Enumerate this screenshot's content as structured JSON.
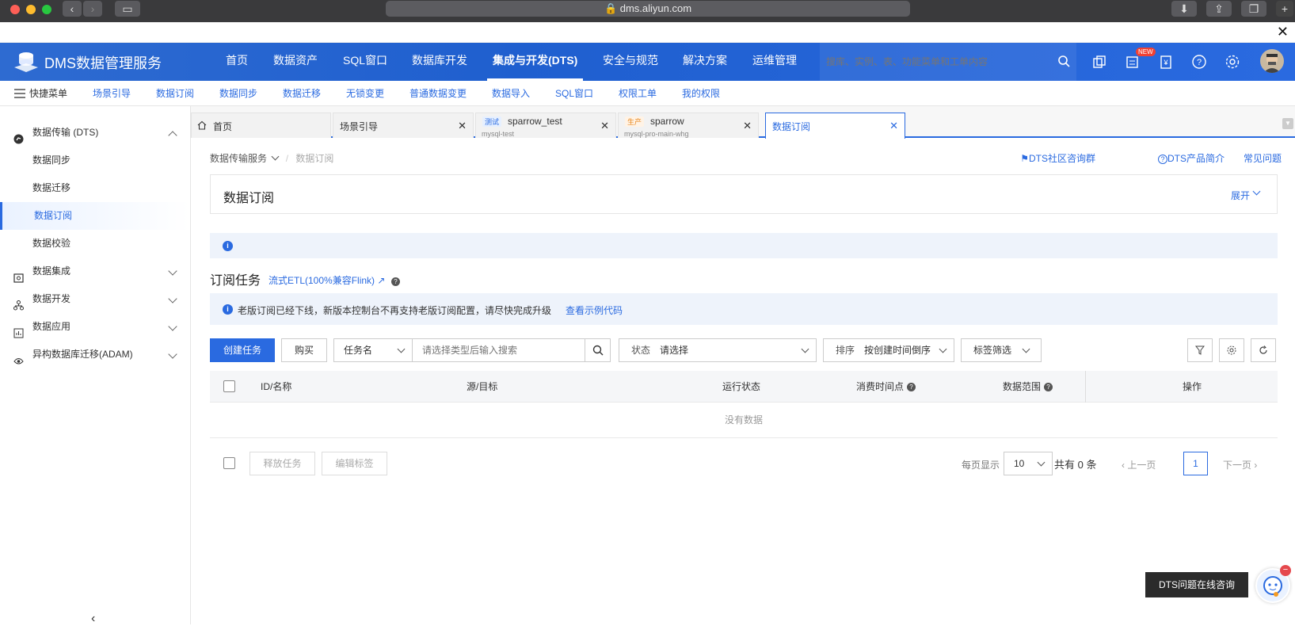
{
  "browser": {
    "url": "dms.aliyun.com"
  },
  "header": {
    "logo_text": "DMS数据管理服务",
    "nav": [
      {
        "label": "首页"
      },
      {
        "label": "数据资产"
      },
      {
        "label": "SQL窗口"
      },
      {
        "label": "数据库开发"
      },
      {
        "label": "集成与开发(DTS)"
      },
      {
        "label": "安全与规范"
      },
      {
        "label": "解决方案"
      },
      {
        "label": "运维管理"
      }
    ],
    "search_placeholder": "搜库、实例、表、功能菜单和工单内容",
    "new_badge": "NEW"
  },
  "quick_menu": {
    "label": "快捷菜单",
    "items": [
      "场景引导",
      "数据订阅",
      "数据同步",
      "数据迁移",
      "无锁变更",
      "普通数据变更",
      "数据导入",
      "SQL窗口",
      "权限工单",
      "我的权限"
    ]
  },
  "sidebar": {
    "dts_title": "数据传输 (DTS)",
    "dts_items": [
      "数据同步",
      "数据迁移",
      "数据订阅",
      "数据校验"
    ],
    "groups": [
      "数据集成",
      "数据开发",
      "数据应用",
      "异构数据库迁移(ADAM)"
    ]
  },
  "tabs": [
    {
      "title": "首页"
    },
    {
      "title": "场景引导"
    },
    {
      "title": "sparrow_test",
      "sub": "mysql-test",
      "env": "测试"
    },
    {
      "title": "sparrow",
      "sub": "mysql-pro-main-whg",
      "env": "生产"
    },
    {
      "title": "数据订阅"
    }
  ],
  "main": {
    "breadcrumb": {
      "parent": "数据传输服务",
      "current": "数据订阅"
    },
    "links": {
      "community": "DTS社区咨询群",
      "intro": "DTS产品简介",
      "faq": "常见问题"
    },
    "panel_title": "数据订阅",
    "expand_label": "展开",
    "section_title": "订阅任务",
    "etl_link": "流式ETL(100%兼容Flink)",
    "notice_text": "老版订阅已经下线，新版本控制台不再支持老版订阅配置，请尽快完成升级",
    "notice_link": "查看示例代码",
    "toolbar": {
      "create_label": "创建任务",
      "buy_label": "购买",
      "field_select": "任务名",
      "search_placeholder": "请选择类型后输入搜索",
      "status_label": "状态",
      "status_placeholder": "请选择",
      "sort_label": "排序",
      "sort_value": "按创建时间倒序",
      "tag_filter": "标签筛选"
    },
    "table": {
      "columns": [
        "ID/名称",
        "源/目标",
        "运行状态",
        "消费时间点",
        "数据范围",
        "操作"
      ],
      "empty_text": "没有数据"
    },
    "footer": {
      "release_label": "释放任务",
      "edit_tag_label": "编辑标签",
      "page_size_label": "每页显示",
      "page_size": "10",
      "total_text": "共有 0 条",
      "prev_label": "上一页",
      "page": "1",
      "next_label": "下一页"
    }
  },
  "help": {
    "bubble": "DTS问题在线咨询"
  },
  "colors": {
    "accent": "#2a6ae0",
    "header_bg": "#1f5fcf",
    "info_bg": "#eef3fb"
  }
}
